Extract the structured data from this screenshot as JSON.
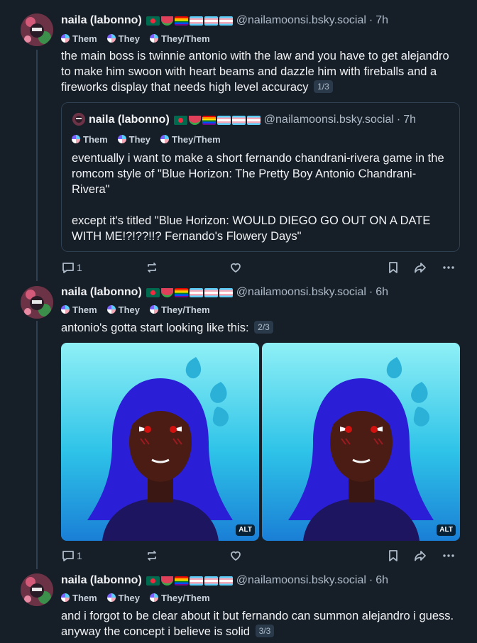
{
  "author": {
    "display_name": "naila (labonno)",
    "handle": "@nailamoonsi.bsky.social",
    "flag_icons": [
      "bangladesh-flag-icon",
      "watermelon-icon",
      "rainbow-flag-icon",
      "transgender-flag-icon",
      "transgender-flag-icon",
      "transgender-flag-icon"
    ],
    "pronouns": [
      "Them",
      "They",
      "They/Them"
    ]
  },
  "posts": [
    {
      "time": "7h",
      "text": "the main boss is twinnie antonio with the law and you have to get alejandro to make him swoon with heart beams and dazzle him with fireballs and a fireworks display that needs high level accuracy",
      "thread_badge": "1/3",
      "quote": {
        "time": "7h",
        "text_p1": "eventually i want to make a short fernando chandrani-rivera game in the romcom style of \"Blue Horizon: The Pretty Boy Antonio Chandrani-Rivera\"",
        "text_p2": "except it's titled \"Blue Horizon: WOULD DIEGO GO OUT ON A DATE WITH ME!?!??!!? Fernando's Flowery Days\""
      },
      "reply_count": "1"
    },
    {
      "time": "6h",
      "text": "antonio's gotta start looking like this:",
      "thread_badge": "2/3",
      "images": [
        {
          "alt_label": "ALT"
        },
        {
          "alt_label": "ALT"
        }
      ],
      "reply_count": "1"
    },
    {
      "time": "6h",
      "text": "and i forgot to be clear about it but fernando can summon alejandro i guess. anyway the concept i believe is solid",
      "thread_badge": "3/3"
    }
  ],
  "icons": {
    "reply": "reply-icon",
    "repost": "repost-icon",
    "like": "heart-icon",
    "bookmark": "bookmark-icon",
    "share": "share-icon",
    "more": "more-icon"
  },
  "colors": {
    "background": "#161e27",
    "thread_line": "#2e4052",
    "muted_text": "#aebbc9"
  }
}
